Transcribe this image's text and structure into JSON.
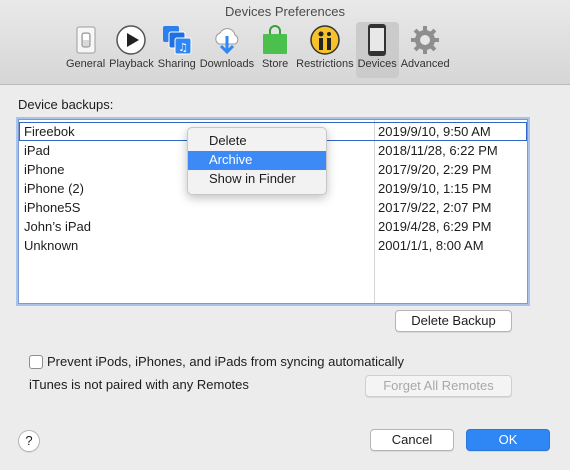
{
  "window": {
    "title": "Devices Preferences"
  },
  "toolbar": {
    "items": [
      {
        "label": "General",
        "icon": "switch-icon",
        "active": false
      },
      {
        "label": "Playback",
        "icon": "play-icon",
        "active": false
      },
      {
        "label": "Sharing",
        "icon": "music-sharing-icon",
        "active": false
      },
      {
        "label": "Downloads",
        "icon": "cloud-download-icon",
        "active": false
      },
      {
        "label": "Store",
        "icon": "shopping-bag-icon",
        "active": false
      },
      {
        "label": "Restrictions",
        "icon": "parental-icon",
        "active": false
      },
      {
        "label": "Devices",
        "icon": "phone-icon",
        "active": true
      },
      {
        "label": "Advanced",
        "icon": "gear-icon",
        "active": false
      }
    ]
  },
  "backups": {
    "label": "Device backups:",
    "rows": [
      {
        "name": "Fireebok",
        "date": "2019/9/10, 9:50 AM",
        "selected": true
      },
      {
        "name": "iPad",
        "date": "2018/11/28, 6:22 PM"
      },
      {
        "name": "iPhone",
        "date": "2017/9/20, 2:29 PM"
      },
      {
        "name": "iPhone (2)",
        "date": "2019/9/10, 1:15 PM"
      },
      {
        "name": "iPhone5S",
        "date": "2017/9/22, 2:07 PM"
      },
      {
        "name": "John’s iPad",
        "date": "2019/4/28, 6:29 PM"
      },
      {
        "name": "Unknown",
        "date": "2001/1/1, 8:00 AM"
      }
    ]
  },
  "context_menu": {
    "items": [
      {
        "label": "Delete",
        "highlighted": false
      },
      {
        "label": "Archive",
        "highlighted": true
      },
      {
        "label": "Show in Finder",
        "highlighted": false
      }
    ]
  },
  "buttons": {
    "delete_backup": "Delete Backup",
    "forget_remotes": "Forget All Remotes",
    "cancel": "Cancel",
    "ok": "OK",
    "help": "?"
  },
  "options": {
    "prevent_sync_label": "Prevent iPods, iPhones, and iPads from syncing automatically",
    "prevent_sync_checked": false,
    "remotes_status": "iTunes is not paired with any Remotes"
  },
  "colors": {
    "accent": "#2f87f5",
    "menu_highlight": "#3d8af7"
  }
}
